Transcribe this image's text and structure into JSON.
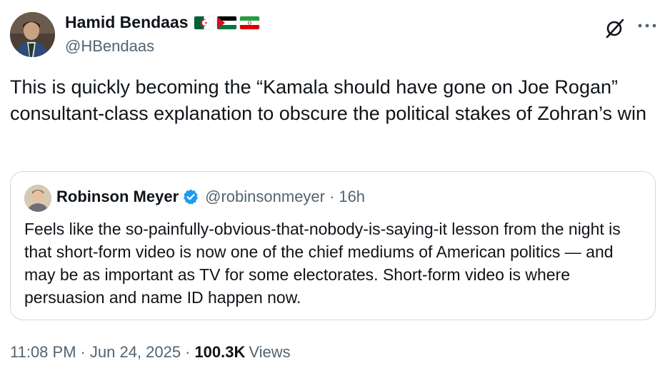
{
  "author": {
    "name": "Hamid Bendaas",
    "handle": "@HBendaas",
    "flags": [
      "algeria-flag",
      "palestine-flag",
      "iran-flag"
    ]
  },
  "tweet": {
    "text": "This is quickly becoming the “Kamala should have gone on Joe Rogan” consultant-class explanation to obscure the political stakes of Zohran’s win"
  },
  "quote": {
    "name": "Robinson Meyer",
    "handle": "@robinsonmeyer",
    "separator": "·",
    "time": "16h",
    "verified_color": "#1d9bf0",
    "text": "Feels like the so-painfully-obvious-that-nobody-is-saying-it lesson from the night is that short-form video is now one of the chief mediums of American politics — and may be as important as TV for some electorates. Short-form video is where persuasion and name ID happen now."
  },
  "footer": {
    "time": "11:08 PM",
    "separator": "·",
    "date": "Jun 24, 2025",
    "views_count": "100.3K",
    "views_label": "Views"
  },
  "icons": {
    "grok": "grok-icon",
    "more": "more-options-icon",
    "verified": "verified-badge-icon"
  }
}
